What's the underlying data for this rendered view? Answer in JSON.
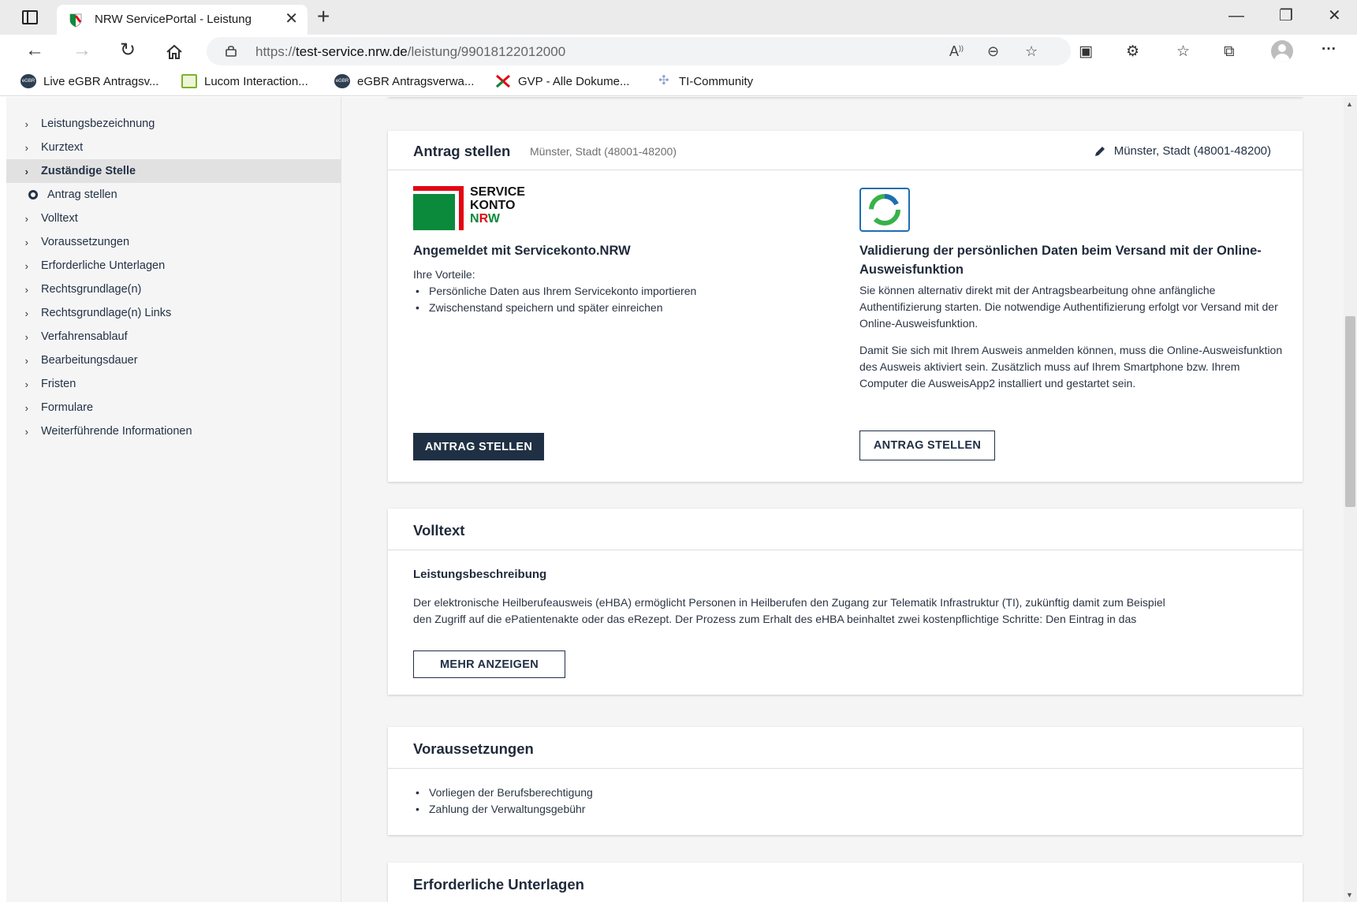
{
  "browser": {
    "tab_title": "NRW ServicePortal - Leistung",
    "tab_close": "✕",
    "new_tab": "+",
    "url_prefix": "https://",
    "url_host": "test-service.nrw.de",
    "url_path": "/leistung/99018122012000",
    "bookmarks": [
      {
        "label": "Live eGBR Antragsv...",
        "icon": "egbr-icon"
      },
      {
        "label": "Lucom Interaction...",
        "icon": "lucom-icon"
      },
      {
        "label": "eGBR Antragsverwa...",
        "icon": "egbr-icon"
      },
      {
        "label": "GVP - Alle Dokume...",
        "icon": "gvp-icon"
      },
      {
        "label": "TI-Community",
        "icon": "ti-icon"
      }
    ]
  },
  "nav": {
    "items": [
      {
        "label": "Leistungsbezeichnung"
      },
      {
        "label": "Kurztext"
      },
      {
        "label": "Zuständige Stelle"
      },
      {
        "label": "Antrag stellen"
      },
      {
        "label": "Volltext"
      },
      {
        "label": "Voraussetzungen"
      },
      {
        "label": "Erforderliche Unterlagen"
      },
      {
        "label": "Rechtsgrundlage(n)"
      },
      {
        "label": "Rechtsgrundlage(n) Links"
      },
      {
        "label": "Verfahrensablauf"
      },
      {
        "label": "Bearbeitungsdauer"
      },
      {
        "label": "Fristen"
      },
      {
        "label": "Formulare"
      },
      {
        "label": "Weiterführende Informationen"
      }
    ]
  },
  "antrag": {
    "title": "Antrag stellen",
    "subtitle": "Münster, Stadt (48001-48200)",
    "location": "Münster, Stadt (48001-48200)",
    "servicekonto": {
      "logo_lines": [
        "SERVICE",
        "KONTO"
      ],
      "logo_nrw": [
        "N",
        "R",
        "W"
      ],
      "heading": "Angemeldet mit Servicekonto.NRW",
      "intro": "Ihre Vorteile:",
      "benefits": [
        "Persönliche Daten aus Ihrem Servicekonto importieren",
        "Zwischenstand speichern und später einreichen"
      ],
      "button": "ANTRAG STELLEN"
    },
    "eid": {
      "heading": "Validierung der persönlichen Daten beim Versand mit der Online-Ausweisfunktion",
      "para1": "Sie können alternativ direkt mit der Antragsbearbeitung ohne anfängliche Authentifizierung starten. Die notwendige Authentifizierung erfolgt vor Versand mit der Online-Ausweisfunktion.",
      "para2": "Damit Sie sich mit Ihrem Ausweis anmelden können, muss die Online-Ausweisfunktion des Ausweis aktiviert sein. Zusätzlich muss auf Ihrem Smartphone bzw. Ihrem Computer die AusweisApp2 installiert und gestartet sein.",
      "button": "ANTRAG STELLEN"
    }
  },
  "volltext": {
    "title": "Volltext",
    "subheading": "Leistungsbeschreibung",
    "text_line1": "Der elektronische Heilberufeausweis (eHBA) ermöglicht Personen in Heilberufen den Zugang zur Telematik Infrastruktur (TI), zukünftig damit zum Beispiel",
    "text_line2": "den Zugriff auf die ePatientenakte oder das eRezept. Der Prozess zum Erhalt des eHBA beinhaltet zwei kostenpflichtige Schritte: Den Eintrag in das",
    "button": "MEHR ANZEIGEN"
  },
  "voraussetzungen": {
    "title": "Voraussetzungen",
    "items": [
      "Vorliegen der Berufsberechtigung",
      "Zahlung der Verwaltungsgebühr"
    ]
  },
  "unterlagen": {
    "title": "Erforderliche Unterlagen"
  },
  "colors": {
    "primary_dark": "#203044",
    "nrw_green": "#0a8a3a",
    "nrw_red": "#e30613",
    "eid_blue": "#1f6db3"
  }
}
